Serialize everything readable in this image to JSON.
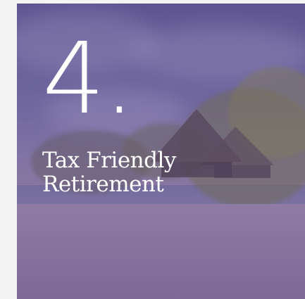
{
  "card": {
    "number": "4.",
    "title_line1": "Tax Friendly",
    "title_line2": "Retirement"
  }
}
